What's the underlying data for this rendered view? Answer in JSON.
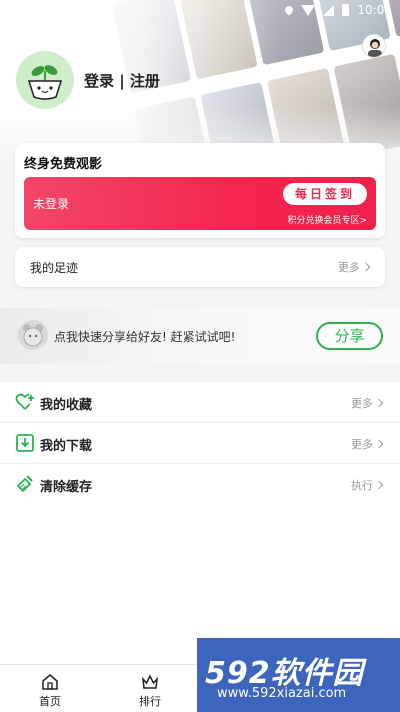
{
  "status_bar": {
    "time": "10:01"
  },
  "header": {
    "login_label": "登录 | 注册"
  },
  "vip_card": {
    "title": "终身免费观影",
    "status": "未登录",
    "signin_label": "每日签到",
    "exchange_link": "积分兑换会员专区>"
  },
  "footprint": {
    "label": "我的足迹",
    "more": "更多"
  },
  "share": {
    "text": "点我快速分享给好友! 赶紧试试吧!",
    "button": "分享"
  },
  "menu": {
    "items": [
      {
        "label": "我的收藏",
        "action": "更多",
        "icon": "heart-plus-icon"
      },
      {
        "label": "我的下载",
        "action": "更多",
        "icon": "download-icon"
      },
      {
        "label": "清除缓存",
        "action": "执行",
        "icon": "broom-icon"
      }
    ]
  },
  "bottom_nav": {
    "items": [
      {
        "label": "首页",
        "icon": "home-icon"
      },
      {
        "label": "排行",
        "icon": "crown-icon"
      }
    ]
  },
  "watermark": {
    "logo": "592软件园",
    "url": "www.592xiazai.com"
  },
  "colors": {
    "accent_green": "#2bb350",
    "vip_red": "#f0204a",
    "watermark_blue": "#2d59b8"
  }
}
